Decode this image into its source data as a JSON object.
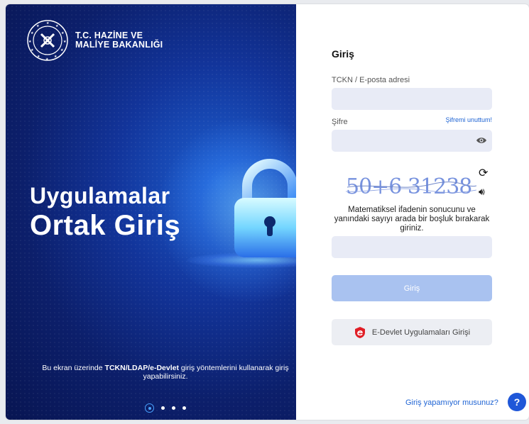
{
  "hero": {
    "org_line1": "T.C. HAZİNE VE",
    "org_line2": "MALİYE BAKANLIĞI",
    "title_line1": "Uygulamalar",
    "title_line2": "Ortak Giriş",
    "note_prefix": "Bu ekran üzerinde ",
    "note_bold": "TCKN/LDAP/e-Devlet",
    "note_suffix": " giriş yöntemlerini kullanarak giriş yapabilirsiniz.",
    "carousel": {
      "count": 4,
      "active": 1
    }
  },
  "form": {
    "title": "Giriş",
    "username_label": "TCKN / E-posta adresi",
    "username_value": "",
    "password_label": "Şifre",
    "password_value": "",
    "forgot_link": "Şifremi unuttum!",
    "captcha_text": "50+6 31238",
    "captcha_hint": "Matematiksel ifadenin sonucunu ve yanındaki sayıyı arada bir boşluk bırakarak giriniz.",
    "captcha_value": "",
    "login_button": "Giriş",
    "edevlet_button": "E-Devlet Uygulamaları Girişi",
    "help_link": "Giriş yapamıyor musunuz?",
    "help_button": "?"
  },
  "icons": [
    "ministry-emblem-icon",
    "lock-illustration-icon",
    "eye-icon",
    "refresh-icon",
    "audio-icon",
    "edevlet-logo-icon",
    "help-icon"
  ],
  "colors": {
    "accent": "#1f57d8",
    "hero_bg": "#0c1f6b",
    "field_bg": "#e8ebf6",
    "login_btn": "#a9c2f0"
  }
}
